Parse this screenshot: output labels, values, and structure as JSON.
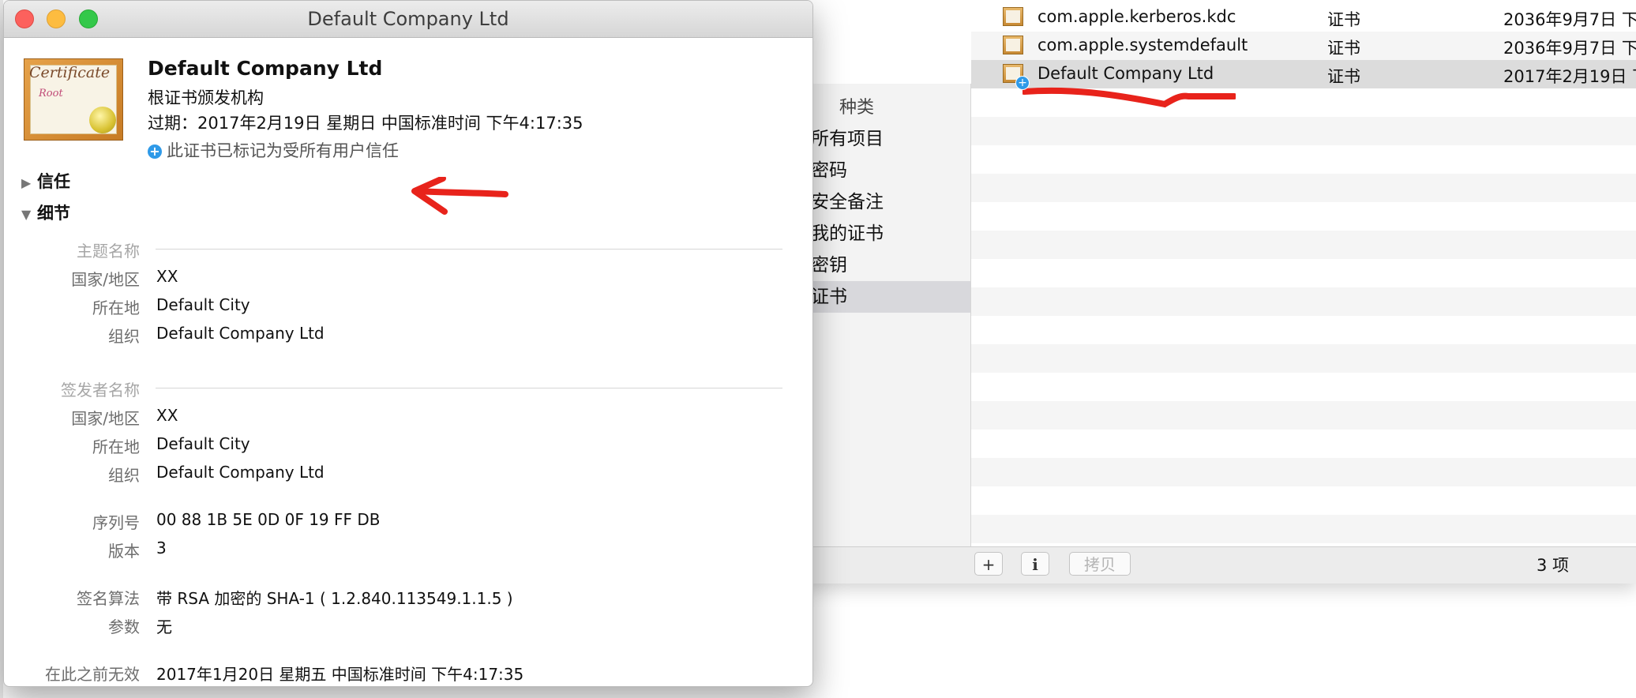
{
  "window": {
    "title": "Default Company Ltd"
  },
  "certificate": {
    "name": "Default Company Ltd",
    "type": "根证书颁发机构",
    "expires": "过期：2017年2月19日 星期日 中国标准时间 下午4:17:35",
    "trust_note": "此证书已标记为受所有用户信任",
    "icon_text_1": "Certificate",
    "icon_text_2": "Root"
  },
  "sections": {
    "trust_label": "信任",
    "details_label": "细节"
  },
  "details": {
    "subject_header": "主题名称",
    "subject": [
      {
        "label": "国家/地区",
        "value": "XX"
      },
      {
        "label": "所在地",
        "value": "Default City"
      },
      {
        "label": "组织",
        "value": "Default Company Ltd"
      }
    ],
    "issuer_header": "签发者名称",
    "issuer": [
      {
        "label": "国家/地区",
        "value": "XX"
      },
      {
        "label": "所在地",
        "value": "Default City"
      },
      {
        "label": "组织",
        "value": "Default Company Ltd"
      }
    ],
    "serial_label": "序列号",
    "serial_value": "00 88 1B 5E 0D 0F 19 FF DB",
    "version_label": "版本",
    "version_value": "3",
    "sig_alg_label": "签名算法",
    "sig_alg_value": "带 RSA 加密的 SHA-1 ( 1.2.840.113549.1.1.5 )",
    "params_label": "参数",
    "params_value": "无",
    "not_before_label": "在此之前无效",
    "not_before_value": "2017年1月20日 星期五 中国标准时间 下午4:17:35"
  },
  "keychain": {
    "category_header": "种类",
    "categories": [
      {
        "label": "所有项目",
        "selected": false
      },
      {
        "label": "密码",
        "selected": false
      },
      {
        "label": "安全备注",
        "selected": false
      },
      {
        "label": "我的证书",
        "selected": false
      },
      {
        "label": "密钥",
        "selected": false
      },
      {
        "label": "证书",
        "selected": true
      }
    ],
    "rows": [
      {
        "name": "com.apple.kerberos.kdc",
        "kind": "证书",
        "date": "2036年9月7日 下",
        "selected": false,
        "trusted_badge": false
      },
      {
        "name": "com.apple.systemdefault",
        "kind": "证书",
        "date": "2036年9月7日 下",
        "selected": false,
        "trusted_badge": false
      },
      {
        "name": "Default Company Ltd",
        "kind": "证书",
        "date": "2017年2月19日 下",
        "selected": true,
        "trusted_badge": true
      }
    ],
    "buttons": {
      "add": "+",
      "info": "i",
      "copy": "拷贝"
    },
    "item_count": "3 项"
  },
  "colors": {
    "annotation_red": "#e8231b",
    "trust_blue": "#2f9ae8"
  }
}
